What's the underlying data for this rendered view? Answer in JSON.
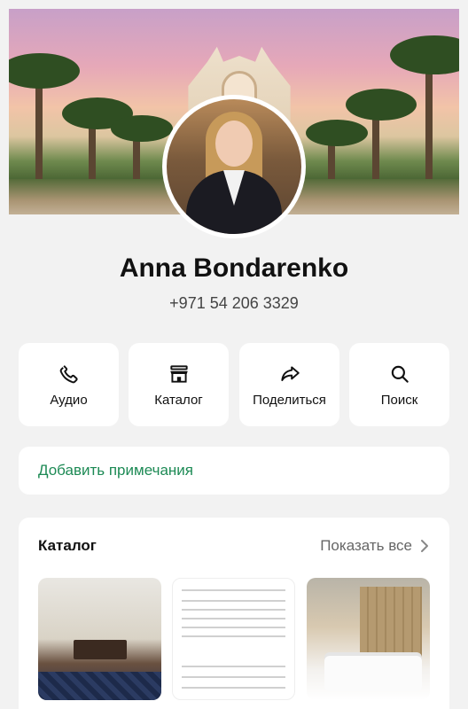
{
  "profile": {
    "name": "Anna Bondarenko",
    "phone": "+971 54 206 3329"
  },
  "actions": [
    {
      "label": "Аудио",
      "icon": "phone-icon"
    },
    {
      "label": "Каталог",
      "icon": "storefront-icon"
    },
    {
      "label": "Поделиться",
      "icon": "share-arrow-icon"
    },
    {
      "label": "Поиск",
      "icon": "search-icon"
    }
  ],
  "notes": {
    "label": "Добавить примечания"
  },
  "catalog": {
    "title": "Каталог",
    "show_all": "Показать все"
  },
  "colors": {
    "accent_green": "#1d8a55",
    "background": "#f2f2f2",
    "card": "#ffffff"
  }
}
